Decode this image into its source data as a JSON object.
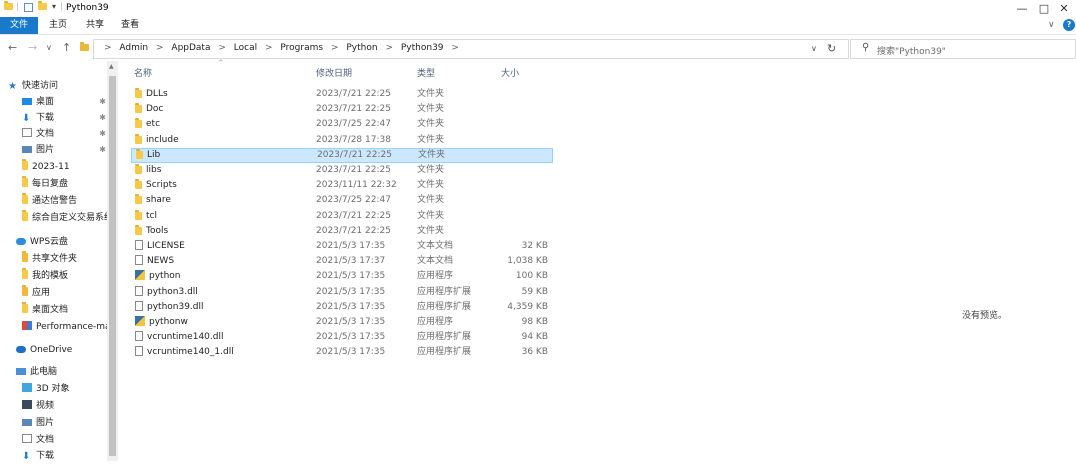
{
  "window": {
    "title": "Python39",
    "minimize": "—",
    "maximize": "□",
    "close": "✕",
    "help": "?"
  },
  "ribbon": {
    "tabs": [
      "文件",
      "主页",
      "共享",
      "查看"
    ],
    "expand": "∨"
  },
  "navbuttons": {
    "back": "←",
    "forward": "→",
    "recent": "∨",
    "up": "↑"
  },
  "address": {
    "crumbs": [
      "Admin",
      "AppData",
      "Local",
      "Programs",
      "Python",
      "Python39"
    ],
    "sep": ">",
    "dropdown": "∨",
    "refresh": "↻"
  },
  "search": {
    "placeholder": "搜索\"Python39\""
  },
  "sidebar": {
    "items": [
      {
        "label": "快速访问",
        "icon": "star-icon",
        "pinned": false
      },
      {
        "label": "桌面",
        "icon": "desktop-icon",
        "pinned": true
      },
      {
        "label": "下载",
        "icon": "download-icon",
        "pinned": true
      },
      {
        "label": "文档",
        "icon": "document-icon",
        "pinned": true
      },
      {
        "label": "图片",
        "icon": "picture-icon",
        "pinned": true
      },
      {
        "label": "2023-11",
        "icon": "folder-icon",
        "pinned": false
      },
      {
        "label": "每日复盘",
        "icon": "folder-icon",
        "pinned": false
      },
      {
        "label": "通达信警告",
        "icon": "folder-icon",
        "pinned": false
      },
      {
        "label": "综合自定义交易系统",
        "icon": "folder-icon",
        "pinned": false
      },
      {
        "label": "WPS云盘",
        "icon": "cloud-icon",
        "pinned": false
      },
      {
        "label": "共享文件夹",
        "icon": "shared-folder-icon",
        "pinned": false
      },
      {
        "label": "我的模板",
        "icon": "folder-icon",
        "pinned": false
      },
      {
        "label": "应用",
        "icon": "app-folder-icon",
        "pinned": false
      },
      {
        "label": "桌面文档",
        "icon": "folder-icon",
        "pinned": false
      },
      {
        "label": "Performance-mas",
        "icon": "app-icon",
        "pinned": false
      },
      {
        "label": "OneDrive",
        "icon": "cloud-icon",
        "pinned": false
      },
      {
        "label": "此电脑",
        "icon": "computer-icon",
        "pinned": false
      },
      {
        "label": "3D 对象",
        "icon": "3d-icon",
        "pinned": false
      },
      {
        "label": "视频",
        "icon": "video-icon",
        "pinned": false
      },
      {
        "label": "图片",
        "icon": "picture-icon",
        "pinned": false
      },
      {
        "label": "文档",
        "icon": "document-icon",
        "pinned": false
      },
      {
        "label": "下载",
        "icon": "download-icon",
        "pinned": false
      }
    ],
    "pin_glyph": "📌"
  },
  "columns": {
    "name": "名称",
    "date": "修改日期",
    "type": "类型",
    "size": "大小"
  },
  "files": [
    {
      "name": "DLLs",
      "date": "2023/7/21 22:25",
      "type": "文件夹",
      "size": "",
      "icon": "folder-icon"
    },
    {
      "name": "Doc",
      "date": "2023/7/21 22:25",
      "type": "文件夹",
      "size": "",
      "icon": "folder-icon"
    },
    {
      "name": "etc",
      "date": "2023/7/25 22:47",
      "type": "文件夹",
      "size": "",
      "icon": "folder-icon"
    },
    {
      "name": "include",
      "date": "2023/7/28 17:38",
      "type": "文件夹",
      "size": "",
      "icon": "folder-icon"
    },
    {
      "name": "Lib",
      "date": "2023/7/21 22:25",
      "type": "文件夹",
      "size": "",
      "icon": "folder-icon",
      "selected": true
    },
    {
      "name": "libs",
      "date": "2023/7/21 22:25",
      "type": "文件夹",
      "size": "",
      "icon": "folder-icon"
    },
    {
      "name": "Scripts",
      "date": "2023/11/11 22:32",
      "type": "文件夹",
      "size": "",
      "icon": "folder-icon"
    },
    {
      "name": "share",
      "date": "2023/7/25 22:47",
      "type": "文件夹",
      "size": "",
      "icon": "folder-icon"
    },
    {
      "name": "tcl",
      "date": "2023/7/21 22:25",
      "type": "文件夹",
      "size": "",
      "icon": "folder-icon"
    },
    {
      "name": "Tools",
      "date": "2023/7/21 22:25",
      "type": "文件夹",
      "size": "",
      "icon": "folder-icon"
    },
    {
      "name": "LICENSE",
      "date": "2021/5/3 17:35",
      "type": "文本文档",
      "size": "32 KB",
      "icon": "text-file-icon"
    },
    {
      "name": "NEWS",
      "date": "2021/5/3 17:37",
      "type": "文本文档",
      "size": "1,038 KB",
      "icon": "text-file-icon"
    },
    {
      "name": "python",
      "date": "2021/5/3 17:35",
      "type": "应用程序",
      "size": "100 KB",
      "icon": "python-exe-icon"
    },
    {
      "name": "python3.dll",
      "date": "2021/5/3 17:35",
      "type": "应用程序扩展",
      "size": "59 KB",
      "icon": "dll-file-icon"
    },
    {
      "name": "python39.dll",
      "date": "2021/5/3 17:35",
      "type": "应用程序扩展",
      "size": "4,359 KB",
      "icon": "dll-file-icon"
    },
    {
      "name": "pythonw",
      "date": "2021/5/3 17:35",
      "type": "应用程序",
      "size": "98 KB",
      "icon": "python-exe-icon"
    },
    {
      "name": "vcruntime140.dll",
      "date": "2021/5/3 17:35",
      "type": "应用程序扩展",
      "size": "94 KB",
      "icon": "dll-file-icon"
    },
    {
      "name": "vcruntime140_1.dll",
      "date": "2021/5/3 17:35",
      "type": "应用程序扩展",
      "size": "36 KB",
      "icon": "dll-file-icon"
    }
  ],
  "preview": {
    "text": "没有预览。"
  },
  "colors": {
    "accent": "#1979ca",
    "selection": "#cce8ff",
    "folder": "#f7c948"
  }
}
